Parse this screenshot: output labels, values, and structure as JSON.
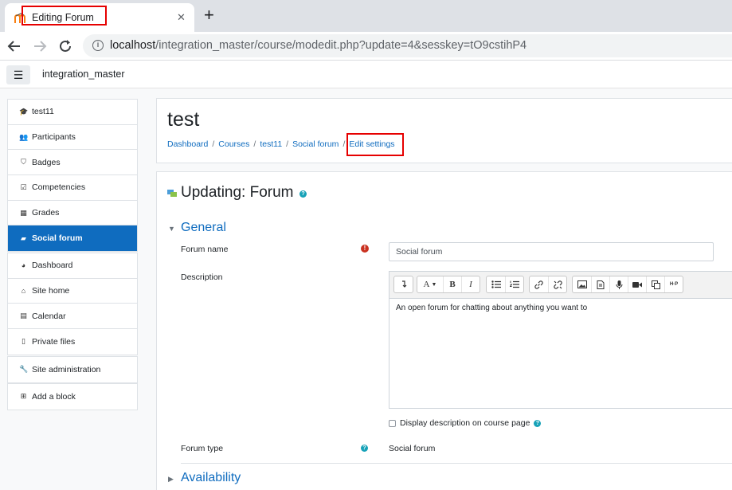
{
  "browser": {
    "tab_title": "Editing Forum",
    "tab_close": "✕",
    "new_tab": "+",
    "url_host": "localhost",
    "url_path": "/integration_master/course/modedit.php?update=4&sesskey=tO9cstihP4"
  },
  "navbar": {
    "menu_icon": "☰",
    "site_name": "integration_master"
  },
  "sidebar": {
    "course_items": [
      {
        "label": "test11",
        "icon": "graduation-cap-icon",
        "glyph": "🎓"
      },
      {
        "label": "Participants",
        "icon": "users-icon",
        "glyph": "👥"
      },
      {
        "label": "Badges",
        "icon": "shield-icon",
        "glyph": "⛉"
      },
      {
        "label": "Competencies",
        "icon": "checkbox-icon",
        "glyph": "☑"
      },
      {
        "label": "Grades",
        "icon": "table-icon",
        "glyph": "▦"
      },
      {
        "label": "Social forum",
        "icon": "forum-icon",
        "glyph": "▰",
        "active": true
      }
    ],
    "site_items": [
      {
        "label": "Dashboard",
        "icon": "dashboard-icon",
        "glyph": "◕"
      },
      {
        "label": "Site home",
        "icon": "home-icon",
        "glyph": "⌂"
      },
      {
        "label": "Calendar",
        "icon": "calendar-icon",
        "glyph": "▤"
      },
      {
        "label": "Private files",
        "icon": "file-icon",
        "glyph": "▯"
      }
    ],
    "admin_item": {
      "label": "Site administration",
      "icon": "wrench-icon",
      "glyph": "🔧"
    },
    "block_item": {
      "label": "Add a block",
      "icon": "plus-square-icon",
      "glyph": "⊞"
    }
  },
  "header": {
    "title": "test",
    "breadcrumb": [
      "Dashboard",
      "Courses",
      "test11",
      "Social forum",
      "Edit settings"
    ],
    "separator": "/"
  },
  "form": {
    "title": "Updating: Forum",
    "help_glyph": "?",
    "section_general": "General",
    "section_availability": "Availability",
    "expanded_glyph": "▼",
    "collapsed_glyph": "▶",
    "forum_name_label": "Forum name",
    "required_glyph": "!",
    "forum_name_value": "Social forum",
    "description_label": "Description",
    "description_text": "An open forum for chatting about anything you want to",
    "display_desc_label": "Display description on course page",
    "forum_type_label": "Forum type",
    "forum_type_value": "Social forum",
    "toolbar_bold": "B",
    "toolbar_italic": "I",
    "toolbar_font": "A",
    "toolbar_h5p": "H·P"
  },
  "colors": {
    "primary": "#0f6cbf",
    "highlight": "#e60000",
    "required": "#ca3120",
    "help": "#17a2b8"
  }
}
